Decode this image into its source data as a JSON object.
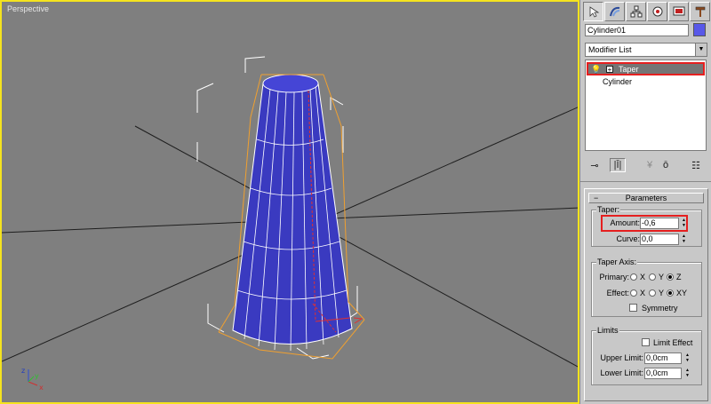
{
  "viewport": {
    "label": "Perspective",
    "axis_labels": {
      "z": "z",
      "y": "y",
      "x": "x"
    }
  },
  "command_panel": {
    "tabs": [
      {
        "icon": "create-arrow-icon",
        "active": true
      },
      {
        "icon": "modify-curve-icon",
        "active": false
      },
      {
        "icon": "hierarchy-icon",
        "active": false
      },
      {
        "icon": "motion-icon",
        "active": false
      },
      {
        "icon": "display-icon",
        "active": false
      },
      {
        "icon": "utilities-hammer-icon",
        "active": false
      }
    ],
    "object_name": "Cylinder01",
    "object_color": "#5858e8",
    "modifier_list": "Modifier List",
    "stack": [
      {
        "label": "Taper",
        "selected": true
      },
      {
        "label": "Cylinder",
        "selected": false
      }
    ],
    "stack_tools": [
      "pin-stack-icon",
      "show-end-result-icon",
      "make-unique-icon",
      "remove-modifier-icon",
      "configure-modifier-sets-icon"
    ],
    "parameters": {
      "title": "Parameters",
      "collapse": "−",
      "taper": {
        "title": "Taper:",
        "amount_label": "Amount:",
        "amount_value": "-0,6",
        "curve_label": "Curve:",
        "curve_value": "0,0"
      },
      "taper_axis": {
        "title": "Taper Axis:",
        "primary_label": "Primary:",
        "effect_label": "Effect:",
        "primary_options": [
          "X",
          "Y",
          "Z"
        ],
        "primary_selected": "Z",
        "effect_options": [
          "X",
          "Y",
          "XY"
        ],
        "effect_selected": "XY",
        "symmetry_label": "Symmetry",
        "symmetry_checked": false
      },
      "limits": {
        "title": "Limits",
        "limit_effect_label": "Limit Effect",
        "limit_effect_checked": false,
        "upper_label": "Upper Limit:",
        "upper_value": "0,0cm",
        "lower_label": "Lower Limit:",
        "lower_value": "0,0cm"
      }
    }
  },
  "colors": {
    "viewport_bg": "#7f7f7f",
    "viewport_border": "#f5e31e",
    "object": "#3a3ac0",
    "selection_bracket": "#ffffff",
    "gizmo": "#f0a030",
    "highlight": "#e51f1f"
  }
}
